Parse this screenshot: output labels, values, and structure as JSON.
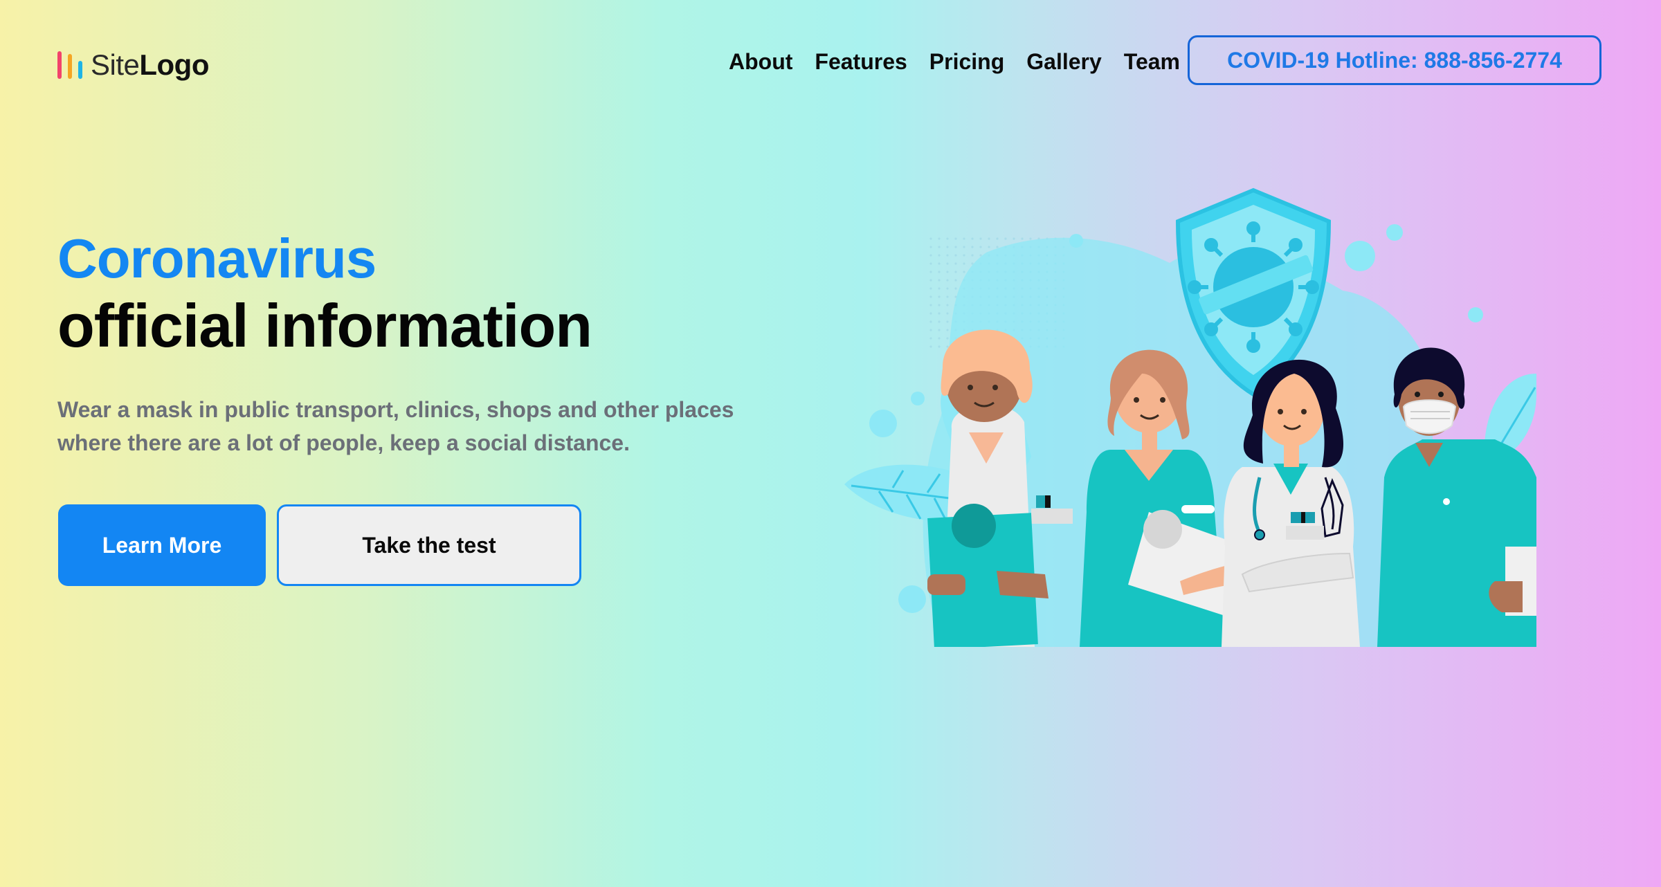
{
  "header": {
    "logo": {
      "text_light": "Site",
      "text_bold": "Logo",
      "bar_colors": [
        "#f2436b",
        "#f5a623",
        "#1fb4e6"
      ]
    },
    "nav": [
      {
        "label": "About"
      },
      {
        "label": "Features"
      },
      {
        "label": "Pricing"
      },
      {
        "label": "Gallery"
      },
      {
        "label": "Team"
      }
    ],
    "hotline_label": "COVID-19 Hotline: 888-856-2774"
  },
  "hero": {
    "title_accent": "Coronavirus",
    "title_main": "official information",
    "description": "Wear a mask in public transport, clinics, shops and other places where there are a lot of people, keep a social distance.",
    "primary_button": "Learn More",
    "secondary_button": "Take the test",
    "illustration": "medical-team-with-virus-shield-illustration"
  },
  "colors": {
    "accent": "#1487f2",
    "teal": "#17c4c2",
    "light_cyan": "#8de8f6"
  }
}
